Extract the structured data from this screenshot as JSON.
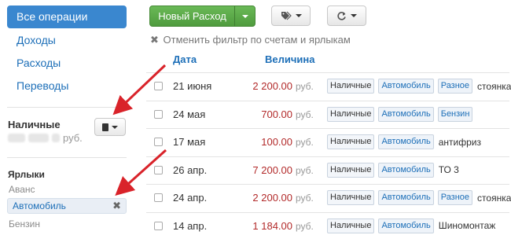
{
  "sidebar": {
    "nav": [
      {
        "label": "Все операции",
        "active": true
      },
      {
        "label": "Доходы"
      },
      {
        "label": "Расходы"
      },
      {
        "label": "Переводы"
      }
    ],
    "account": {
      "name": "Наличные",
      "currency": "руб."
    },
    "tags_heading": "Ярлыки",
    "tags": [
      {
        "label": "Аванс"
      },
      {
        "label": "Автомобиль",
        "active": true
      },
      {
        "label": "Бензин"
      }
    ]
  },
  "toolbar": {
    "new_expense_label": "Новый Расход",
    "tags_icon": "tags-icon",
    "refresh_icon": "refresh-icon"
  },
  "filter": {
    "clear_label": "Отменить фильтр по счетам и ярлыкам"
  },
  "table": {
    "columns": {
      "date": "Дата",
      "amount": "Величина"
    },
    "rows": [
      {
        "date": "21 июня",
        "amount": "2 200.00",
        "currency": "руб.",
        "tags": [
          "Наличные",
          "Автомобиль",
          "Разное"
        ],
        "note": "стоянка"
      },
      {
        "date": "24 мая",
        "amount": "700.00",
        "currency": "руб.",
        "tags": [
          "Наличные",
          "Автомобиль",
          "Бензин"
        ],
        "note": ""
      },
      {
        "date": "17 мая",
        "amount": "100.00",
        "currency": "руб.",
        "tags": [
          "Наличные",
          "Автомобиль"
        ],
        "note": "антифриз"
      },
      {
        "date": "26 апр.",
        "amount": "7 200.00",
        "currency": "руб.",
        "tags": [
          "Наличные",
          "Автомобиль"
        ],
        "note": "ТО 3"
      },
      {
        "date": "24 апр.",
        "amount": "2 200.00",
        "currency": "руб.",
        "tags": [
          "Наличные",
          "Автомобиль",
          "Разное"
        ],
        "note": "стоянка"
      },
      {
        "date": "14 апр.",
        "amount": "1 184.00",
        "currency": "руб.",
        "tags": [
          "Наличные",
          "Автомобиль"
        ],
        "note": "Шиномонтаж"
      }
    ]
  },
  "colors": {
    "accent": "#3a87cf",
    "new_button": "#5aa848",
    "amount": "#b22a2a",
    "arrow": "#d9232a"
  }
}
